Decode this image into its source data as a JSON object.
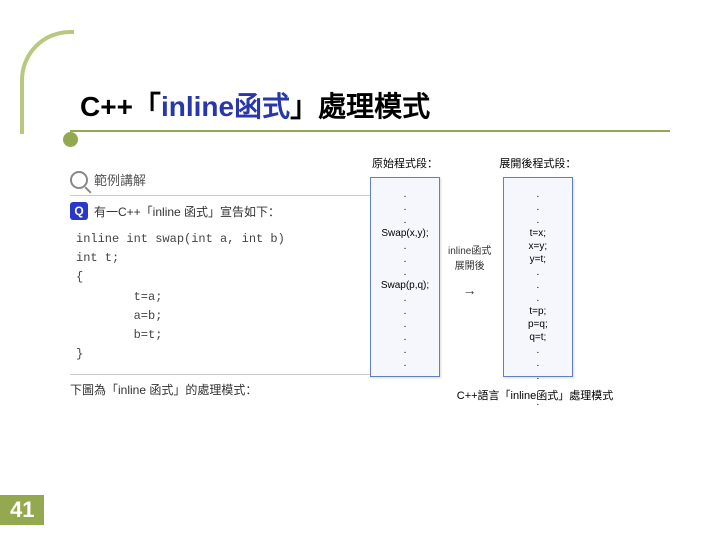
{
  "title": {
    "part1": "C++「",
    "part2": "inline函式",
    "part3": "」處理模式"
  },
  "example_label": "範例講解",
  "q_text": "有一C++「inline 函式」宣告如下：",
  "code": "inline int swap(int a, int b)\nint t;\n{\n        t=a;\n        a=b;\n        b=t;\n}",
  "note": "下圖為「inline 函式」的處理模式：",
  "diagram": {
    "left_title": "原始程式段：",
    "right_title": "展開後程式段：",
    "left_box": ".\n.\n.\nSwap(x,y);\n.\n.\n.\nSwap(p,q);\n.\n.\n.\n.\n.\n.",
    "right_box": ".\n.\n.\nt=x;\nx=y;\ny=t;\n.\n.\n.\nt=p;\np=q;\nq=t;\n.\n.\n.\n.\n.",
    "arrow_label1": "inline函式",
    "arrow_label2": "展開後",
    "caption": "C++語言「inline函式」處理模式"
  },
  "page_number": "41"
}
